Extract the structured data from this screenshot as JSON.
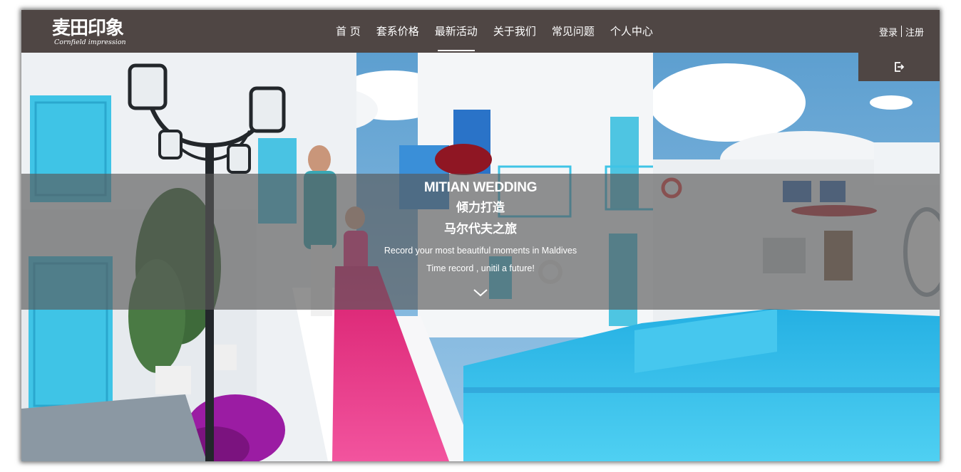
{
  "header": {
    "logo_main": "麦田印象",
    "logo_sub": "Cornfield impression",
    "nav": [
      {
        "label": "首 页"
      },
      {
        "label": "套系价格"
      },
      {
        "label": "最新活动",
        "active": true
      },
      {
        "label": "关于我们"
      },
      {
        "label": "常见问题"
      },
      {
        "label": "个人中心"
      }
    ],
    "login_label": "登录",
    "register_label": "注册"
  },
  "hero": {
    "title_en": "MITIAN WEDDING",
    "title_cn_1": "倾力打造",
    "title_cn_2": "马尔代夫之旅",
    "tagline_1": "Record your most beautiful moments in Maldives",
    "tagline_2": "Time record , unitil a future!",
    "exit_icon": "exit-icon",
    "scroll_icon": "chevron-down-icon"
  },
  "colors": {
    "header_bg": "#4f4644",
    "overlay_bg": "rgba(90,90,90,0.66)",
    "pool_blue": "#2cb7e6",
    "door_cyan": "#3fc4e6",
    "dress_pink": "#e83a8f"
  }
}
